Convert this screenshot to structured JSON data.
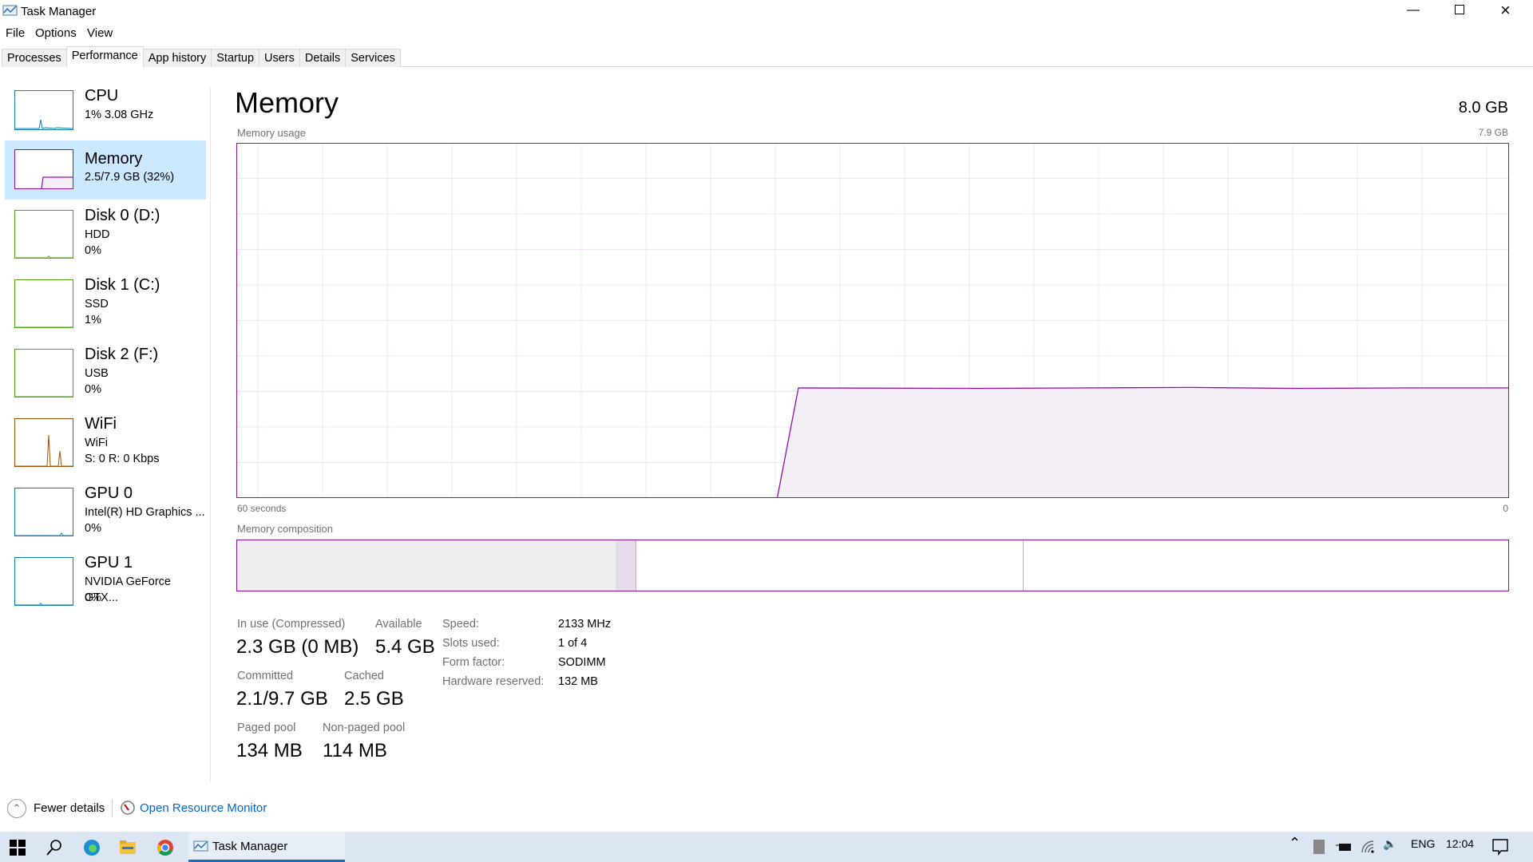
{
  "window": {
    "title": "Task Manager",
    "minimize_icon": "minimize-icon",
    "maximize_icon": "restore-icon",
    "close_icon": "close-icon"
  },
  "menu": [
    "File",
    "Options",
    "View"
  ],
  "tabs": [
    {
      "label": "Processes"
    },
    {
      "label": "Performance",
      "active": true
    },
    {
      "label": "App history"
    },
    {
      "label": "Startup"
    },
    {
      "label": "Users"
    },
    {
      "label": "Details"
    },
    {
      "label": "Services"
    }
  ],
  "sidebar": {
    "items": [
      {
        "title": "CPU",
        "lines": [
          "1%  3.08 GHz"
        ],
        "color": "#117dbb"
      },
      {
        "title": "Memory",
        "lines": [
          "2.5/7.9 GB (32%)"
        ],
        "color": "#8b12ae",
        "selected": true
      },
      {
        "title": "Disk 0 (D:)",
        "lines": [
          "HDD",
          "0%"
        ],
        "color": "#4da60c"
      },
      {
        "title": "Disk 1 (C:)",
        "lines": [
          "SSD",
          "1%"
        ],
        "color": "#4da60c"
      },
      {
        "title": "Disk 2 (F:)",
        "lines": [
          "USB",
          "0%"
        ],
        "color": "#4da60c"
      },
      {
        "title": "WiFi",
        "lines": [
          "WiFi",
          "S: 0  R: 0 Kbps"
        ],
        "color": "#a74f01"
      },
      {
        "title": "GPU 0",
        "lines": [
          "Intel(R) HD Graphics ...",
          "0%"
        ],
        "color": "#117dbb"
      },
      {
        "title": "GPU 1",
        "lines": [
          "NVIDIA GeForce GTX...",
          "0%"
        ],
        "color": "#117dbb"
      }
    ]
  },
  "main": {
    "heading": "Memory",
    "total": "8.0 GB",
    "usage_label": "Memory usage",
    "usage_max": "7.9 GB",
    "time_left": "60 seconds",
    "time_right": "0",
    "composition_label": "Memory composition",
    "stats": {
      "in_use_label": "In use (Compressed)",
      "in_use": "2.3 GB (0 MB)",
      "available_label": "Available",
      "available": "5.4 GB",
      "committed_label": "Committed",
      "committed": "2.1/9.7 GB",
      "cached_label": "Cached",
      "cached": "2.5 GB",
      "paged_label": "Paged pool",
      "paged": "134 MB",
      "nonpaged_label": "Non-paged pool",
      "nonpaged": "114 MB"
    },
    "hardware": [
      {
        "label": "Speed:",
        "value": "2133 MHz"
      },
      {
        "label": "Slots used:",
        "value": "1 of 4"
      },
      {
        "label": "Form factor:",
        "value": "SODIMM"
      },
      {
        "label": "Hardware reserved:",
        "value": "132 MB"
      }
    ]
  },
  "chart_data": {
    "type": "area",
    "xlabel": "60 seconds",
    "ylim": [
      0,
      7.9
    ],
    "xlim": [
      60,
      0
    ],
    "grid": true,
    "color": "#8b12ae",
    "x": [
      60,
      34.5,
      33.5,
      25,
      20,
      15,
      10,
      5,
      0
    ],
    "values": [
      0,
      0,
      2.45,
      2.44,
      2.45,
      2.46,
      2.44,
      2.45,
      2.45
    ],
    "composition": {
      "in_use_fraction": 0.298,
      "modified_fraction": 0.016,
      "standby_fraction": 0.305,
      "free_fraction": 0.381
    }
  },
  "footer": {
    "fewer_details": "Fewer details",
    "resource_monitor": "Open Resource Monitor"
  },
  "taskbar": {
    "pinned": [
      "windows-start-icon",
      "search-icon",
      "edge-icon",
      "file-explorer-icon",
      "chrome-icon"
    ],
    "active_app": "Task Manager",
    "language": "ENG",
    "clock": "12:04"
  },
  "colors": {
    "accent": "#8b12ae",
    "selection": "#cce8ff",
    "link": "#0066cc",
    "taskbar": "#dbe6f2"
  }
}
